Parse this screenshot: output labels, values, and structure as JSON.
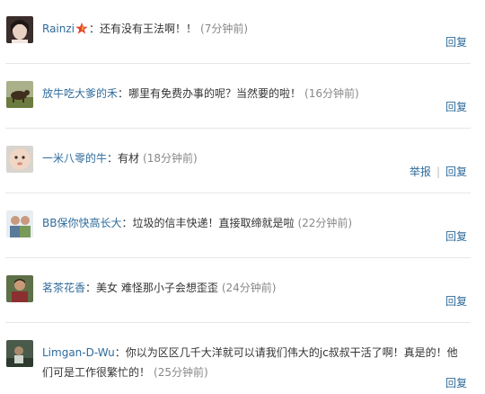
{
  "comments": [
    {
      "user": "Rainzi",
      "vip": true,
      "text": "：还有没有王法啊！！",
      "time": "(7分钟前)",
      "actions": [
        "回复"
      ]
    },
    {
      "user": "放牛吃大爹的禾",
      "vip": false,
      "text": "：哪里有免费办事的呢？当然要的啦！",
      "time": "(16分钟前)",
      "actions": [
        "回复"
      ]
    },
    {
      "user": "一米八零的牛",
      "vip": false,
      "text": "：有材",
      "time": "(18分钟前)",
      "actions": [
        "举报",
        "回复"
      ]
    },
    {
      "user": "BB保你快高长大",
      "vip": false,
      "text": "：垃圾的信丰快递！直接取缔就是啦",
      "time": "(22分钟前)",
      "actions": [
        "回复"
      ]
    },
    {
      "user": "茗茶花香",
      "vip": false,
      "text": "：美女 难怪那小子会想歪歪",
      "time": "(24分钟前)",
      "actions": [
        "回复"
      ]
    },
    {
      "user": "Limgan-D-Wu",
      "vip": false,
      "text": "：你以为区区几千大洋就可以请我们伟大的jc叔叔干活了啊！真是的！他们可是工作很繁忙的！",
      "time": "(25分钟前)",
      "actions": [
        "回复"
      ]
    }
  ],
  "colors": {
    "link": "#2e6b9b",
    "time": "#888888",
    "divider": "#e6e6e6"
  },
  "icons": {
    "vip": "red-star-icon"
  }
}
